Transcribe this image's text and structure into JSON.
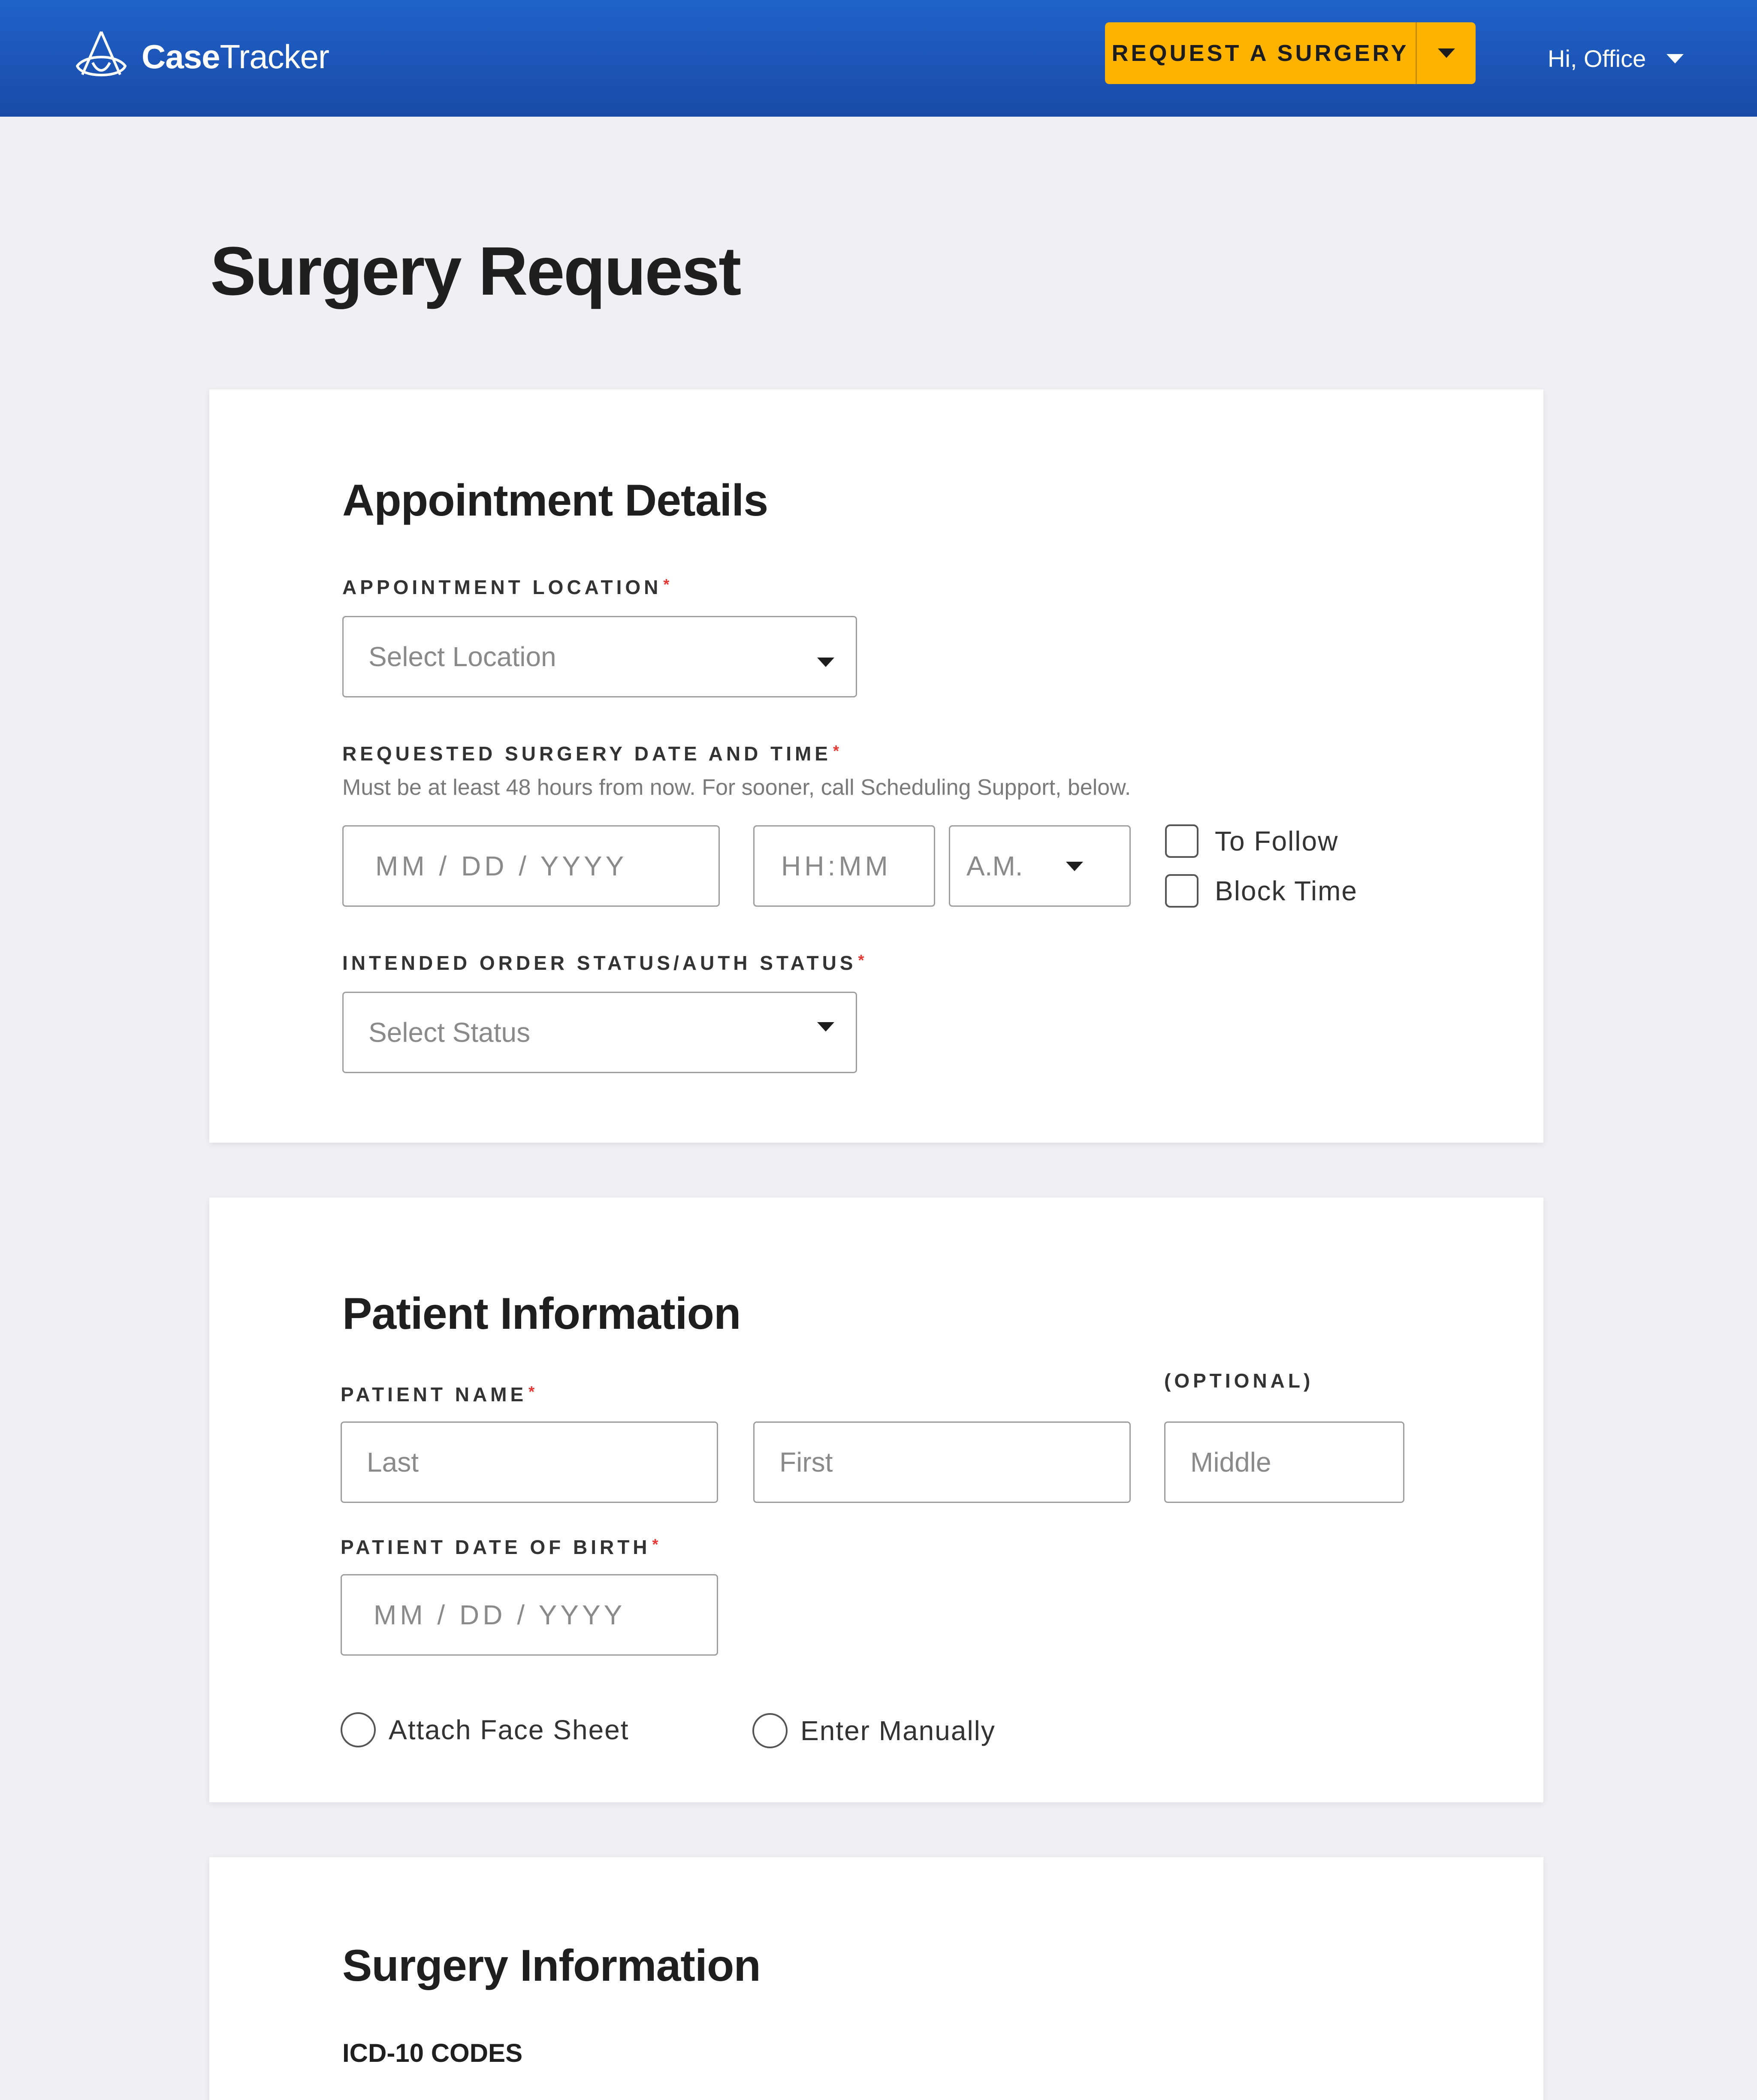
{
  "header": {
    "logo_bold": "Case",
    "logo_light": "Tracker",
    "request_button": "REQUEST A SURGERY",
    "user_greeting": "Hi, Office"
  },
  "page": {
    "title": "Surgery Request"
  },
  "appointment": {
    "title": "Appointment Details",
    "location_label": "APPOINTMENT LOCATION",
    "location_placeholder": "Select Location",
    "date_label": "REQUESTED SURGERY DATE AND TIME",
    "date_hint": "Must be at least 48 hours from now. For sooner, call Scheduling Support, below.",
    "date_placeholder": "MM / DD / YYYY",
    "time_placeholder": "HH:MM",
    "ampm_value": "A.M.",
    "to_follow_label": "To Follow",
    "block_time_label": "Block Time",
    "status_label": "INTENDED ORDER STATUS/AUTH STATUS",
    "status_placeholder": "Select Status"
  },
  "patient": {
    "title": "Patient Information",
    "name_label": "PATIENT NAME",
    "optional_label": "(OPTIONAL)",
    "last_placeholder": "Last",
    "first_placeholder": "First",
    "middle_placeholder": "Middle",
    "dob_label": "PATIENT DATE OF BIRTH",
    "dob_placeholder": "MM / DD / YYYY",
    "attach_face_sheet": "Attach Face Sheet",
    "enter_manually": "Enter Manually"
  },
  "surgery": {
    "title": "Surgery Information",
    "icd_heading": "ICD-10 CODES"
  },
  "colors": {
    "header_blue": "#1f63c9",
    "accent_yellow": "#ffb300",
    "required_red": "#e53935"
  }
}
